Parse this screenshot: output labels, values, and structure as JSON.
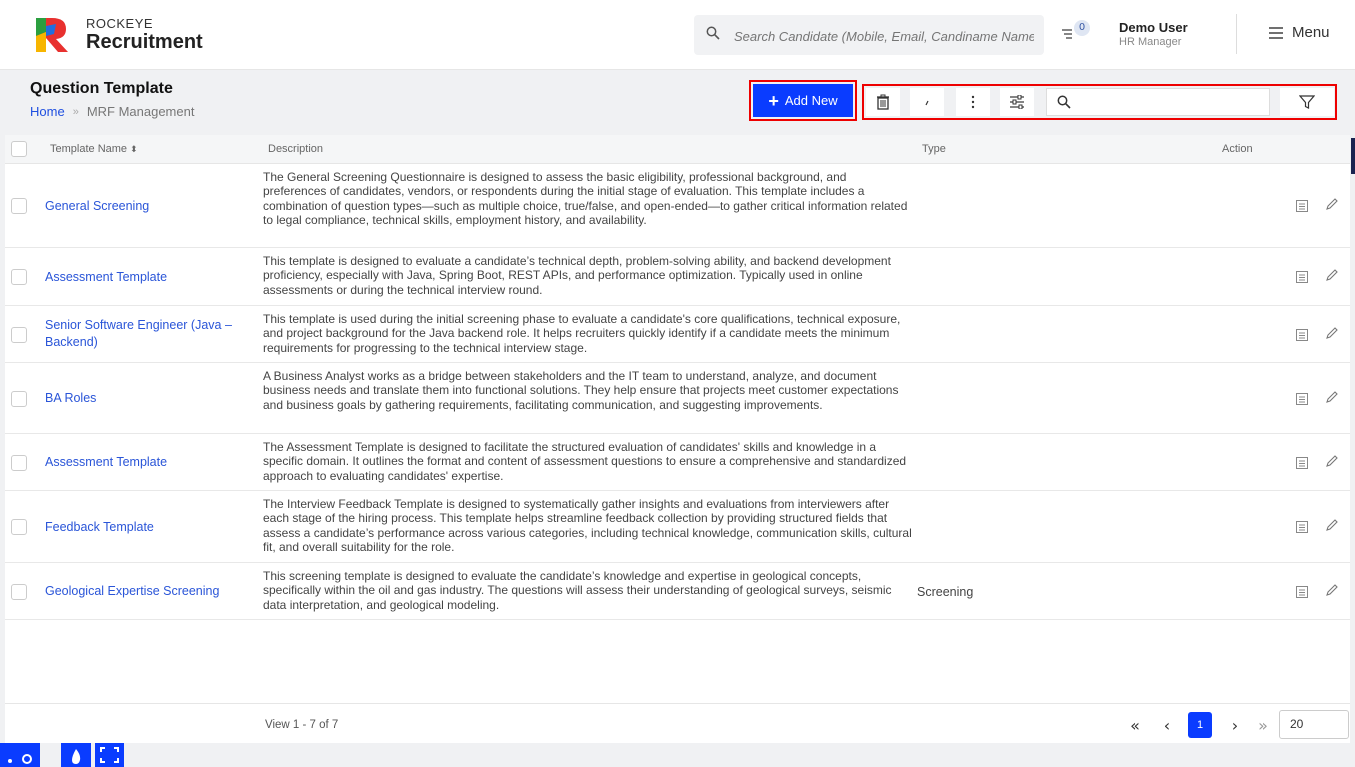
{
  "header": {
    "brand_top": "ROCKEYE",
    "brand_main": "Recruitment",
    "search_placeholder": "Search Candidate (Mobile, Email, Candiname Name)",
    "notification_count": "0",
    "user_name": "Demo User",
    "user_role": "HR Manager",
    "menu_label": "Menu"
  },
  "page": {
    "title": "Question Template",
    "breadcrumb_home": "Home",
    "breadcrumb_current": "MRF Management",
    "add_new_label": "Add New"
  },
  "table": {
    "columns": [
      "Template Name",
      "Description",
      "Type",
      "Action"
    ],
    "rows": [
      {
        "name": "General Screening",
        "description": "The General Screening Questionnaire is designed to assess the basic eligibility, professional background, and preferences of candidates, vendors, or respondents during the initial stage of evaluation. This template includes a combination of question types—such as multiple choice, true/false, and open-ended—to gather critical information related to legal compliance, technical skills, employment history, and availability.",
        "type": ""
      },
      {
        "name": "Assessment Template",
        "description": "This template is designed to evaluate a candidate’s technical depth, problem-solving ability, and backend development proficiency, especially with Java, Spring Boot, REST APIs, and performance optimization. Typically used in online assessments or during the technical interview round.",
        "type": ""
      },
      {
        "name": "Senior Software Engineer (Java – Backend)",
        "description": "This template is used during the initial screening phase to evaluate a candidate's core qualifications, technical exposure, and project background for the Java backend role. It helps recruiters quickly identify if a candidate meets the minimum requirements for progressing to the technical interview stage.",
        "type": ""
      },
      {
        "name": "BA Roles",
        "description": "A Business Analyst works as a bridge between stakeholders and the IT team to understand, analyze, and document business needs and translate them into functional solutions. They help ensure that projects meet customer expectations and business goals by gathering requirements, facilitating communication, and suggesting improvements.",
        "type": ""
      },
      {
        "name": "Assessment Template",
        "description": "The Assessment Template is designed to facilitate the structured evaluation of candidates' skills and knowledge in a specific domain. It outlines the format and content of assessment questions to ensure a comprehensive and standardized approach to evaluating candidates' expertise.",
        "type": ""
      },
      {
        "name": "Feedback Template",
        "description": "The Interview Feedback Template is designed to systematically gather insights and evaluations from interviewers after each stage of the hiring process. This template helps streamline feedback collection by providing structured fields that assess a candidate’s performance across various categories, including technical knowledge, communication skills, cultural fit, and overall suitability for the role.",
        "type": ""
      },
      {
        "name": "Geological Expertise Screening",
        "description": "This screening template is designed to evaluate the candidate’s knowledge and expertise in geological concepts, specifically within the oil and gas industry. The questions will assess their understanding of geological surveys, seismic data interpretation, and geological modeling.",
        "type": "Screening"
      }
    ]
  },
  "footer": {
    "view_text": "View 1 - 7 of 7",
    "current_page": "1",
    "page_size": "20"
  },
  "colors": {
    "accent": "#0a3cff",
    "link": "#2a55d8",
    "highlight_border": "#e00000"
  }
}
